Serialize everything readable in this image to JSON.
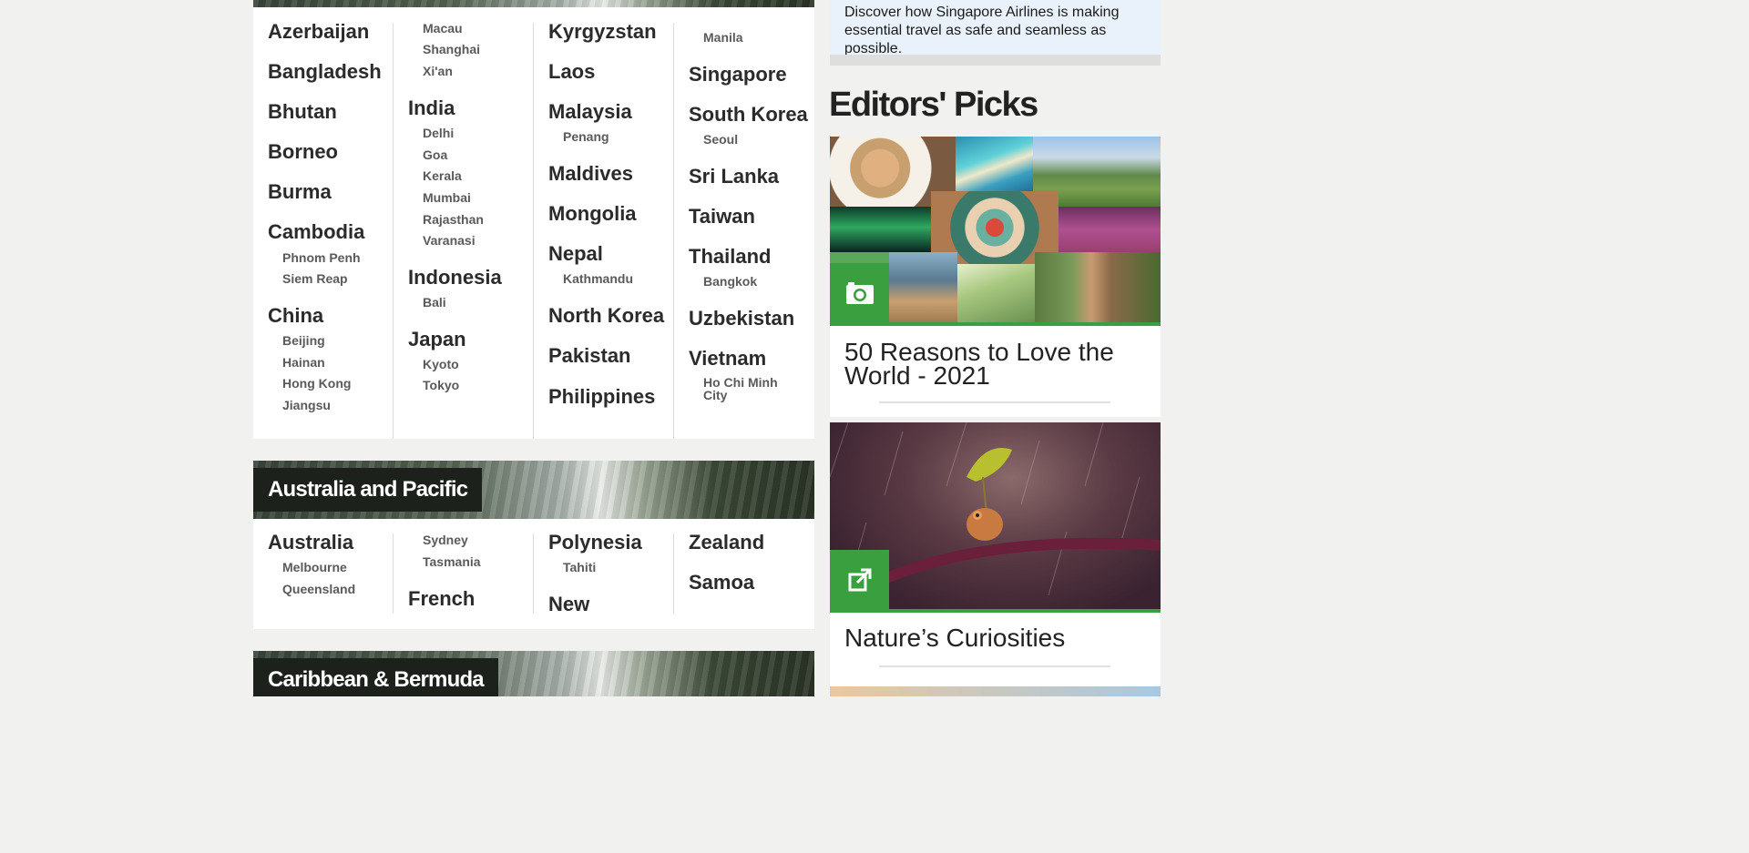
{
  "asia": {
    "columns": [
      [
        {
          "country": "Azerbaijan",
          "cities": []
        },
        {
          "country": "Bangladesh",
          "cities": []
        },
        {
          "country": "Bhutan",
          "cities": []
        },
        {
          "country": "Borneo",
          "cities": []
        },
        {
          "country": "Burma",
          "cities": []
        },
        {
          "country": "Cambodia",
          "cities": [
            "Phnom Penh",
            "Siem Reap"
          ]
        },
        {
          "country": "China",
          "cities": [
            "Beijing",
            "Hainan",
            "Hong Kong",
            "Jiangsu"
          ]
        }
      ],
      [
        {
          "country": "",
          "cities": [
            "Macau",
            "Shanghai",
            "Xi'an"
          ]
        },
        {
          "country": "India",
          "cities": [
            "Delhi",
            "Goa",
            "Kerala",
            "Mumbai",
            "Rajasthan",
            "Varanasi"
          ]
        },
        {
          "country": "Indonesia",
          "cities": [
            "Bali"
          ]
        },
        {
          "country": "Japan",
          "cities": [
            "Kyoto",
            "Tokyo"
          ]
        }
      ],
      [
        {
          "country": "Kyrgyzstan",
          "cities": []
        },
        {
          "country": "Laos",
          "cities": []
        },
        {
          "country": "Malaysia",
          "cities": [
            "Penang"
          ]
        },
        {
          "country": "Maldives",
          "cities": []
        },
        {
          "country": "Mongolia",
          "cities": []
        },
        {
          "country": "Nepal",
          "cities": [
            "Kathmandu"
          ]
        },
        {
          "country": "North Korea",
          "cities": []
        },
        {
          "country": "Pakistan",
          "cities": []
        },
        {
          "country": "Philippines",
          "cities": []
        }
      ],
      [
        {
          "country": "",
          "cities": [
            "Manila"
          ]
        },
        {
          "country": "Singapore",
          "cities": []
        },
        {
          "country": "South Korea",
          "cities": [
            "Seoul"
          ]
        },
        {
          "country": "Sri Lanka",
          "cities": []
        },
        {
          "country": "Taiwan",
          "cities": []
        },
        {
          "country": "Thailand",
          "cities": [
            "Bangkok"
          ]
        },
        {
          "country": "Uzbekistan",
          "cities": []
        },
        {
          "country": "Vietnam",
          "cities": [
            "Ho Chi Minh City"
          ]
        }
      ]
    ]
  },
  "australia": {
    "heading": "Australia and Pacific",
    "columns": [
      [
        {
          "country": "Australia",
          "cities": [
            "Melbourne",
            "Queensland"
          ]
        }
      ],
      [
        {
          "country": "",
          "cities": [
            "Sydney",
            "Tasmania"
          ]
        },
        {
          "country": "French",
          "cities": []
        }
      ],
      [
        {
          "country": "Polynesia",
          "cities": [
            "Tahiti"
          ]
        },
        {
          "country": "New",
          "cities": []
        }
      ],
      [
        {
          "country": "Zealand",
          "cities": []
        },
        {
          "country": "Samoa",
          "cities": []
        }
      ]
    ]
  },
  "caribbean": {
    "heading": "Caribbean & Bermuda"
  },
  "sidebar": {
    "promo_text": "Discover how Singapore Airlines is making essential travel as safe and seamless as possible.",
    "editors_picks_title": "Editors' Picks",
    "picks": [
      {
        "title": "50 Reasons to Love the World - 2021",
        "icon": "camera-icon"
      },
      {
        "title": "Nature’s Curiosities",
        "icon": "external-link-icon"
      }
    ]
  },
  "colors": {
    "accent_green": "#3a9f3f",
    "banner_label_bg": "#1d211c",
    "promo_bg": "#e9f2fb"
  }
}
